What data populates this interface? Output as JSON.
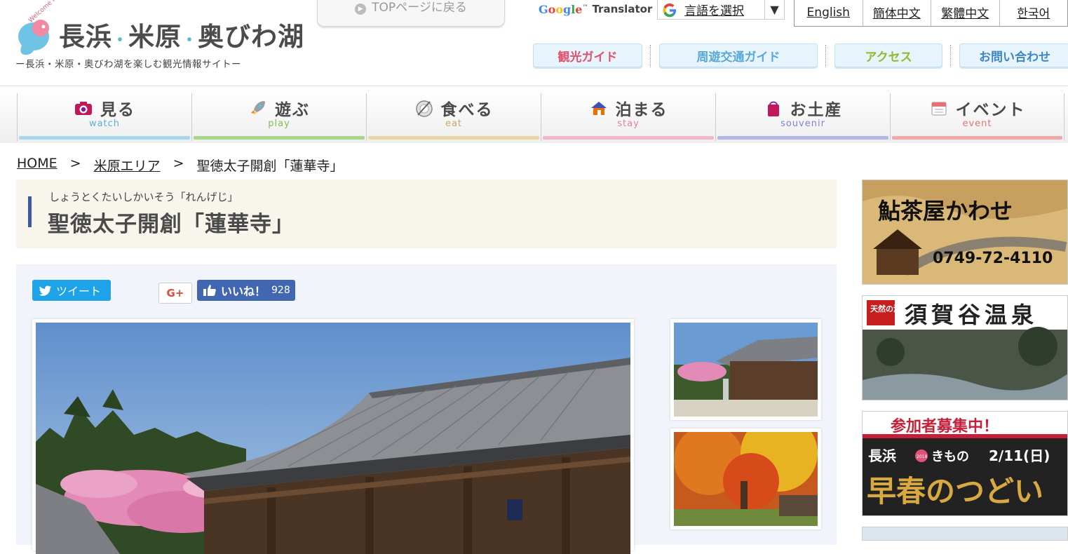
{
  "header": {
    "logo": {
      "welcome": "Welcome Here",
      "title_parts": [
        "長浜",
        "米原",
        "奥びわ湖"
      ],
      "separator": "・",
      "subtitle": "ー長浜・米原・奥びわ湖を楽しむ観光情報サイトー"
    },
    "top_back_label": "TOPページに戻る",
    "translator": {
      "brand_letters": [
        "G",
        "o",
        "o",
        "g",
        "l",
        "e"
      ],
      "brand_tm": "™",
      "label": "Translator",
      "select_label": "言語を選択",
      "arrow": "▼"
    },
    "languages": [
      "English",
      "簡体中文",
      "繁體中文",
      "한국어"
    ],
    "subnav": [
      {
        "label": "観光ガイド",
        "color": "#e0506b"
      },
      {
        "label": "周遊交通ガイド",
        "color": "#58a9d6"
      },
      {
        "label": "アクセス",
        "color": "#8dbb2f"
      },
      {
        "label": "お問い合わせ",
        "color": "#3e86c6"
      }
    ]
  },
  "main_nav": [
    {
      "label": "見る",
      "en": "watch",
      "icon": "camera-icon",
      "color": "#a6d8ec",
      "en_color": "#5bb0d6"
    },
    {
      "label": "遊ぶ",
      "en": "play",
      "icon": "rocket-icon",
      "color": "#a7d58a",
      "en_color": "#7fbf4d"
    },
    {
      "label": "食べる",
      "en": "eat",
      "icon": "dish-icon",
      "color": "#e8d7a4",
      "en_color": "#c9a860"
    },
    {
      "label": "泊まる",
      "en": "stay",
      "icon": "house-icon",
      "color": "#f2b6c6",
      "en_color": "#e57f9c"
    },
    {
      "label": "お土産",
      "en": "souvenir",
      "icon": "bag-icon",
      "color": "#b2b6e8",
      "en_color": "#7b84d6"
    },
    {
      "label": "イベント",
      "en": "event",
      "icon": "calendar-icon",
      "color": "#f1a8a8",
      "en_color": "#e07474"
    }
  ],
  "breadcrumb": {
    "home": "HOME",
    "sep": ">",
    "area": "米原エリア",
    "current": "聖徳太子開創「蓮華寺」"
  },
  "page": {
    "ruby": "しょうとくたいしかいそう「れんげじ」",
    "title": "聖徳太子開創「蓮華寺」"
  },
  "social": {
    "tweet_label": "ツイート",
    "gplus_label": "G+",
    "like_label": "いいね！",
    "like_count": "928"
  },
  "banners": [
    {
      "name": "ayuchaya-kawase-banner",
      "title": "鮎茶屋かわせ",
      "phone": "0749-72-4110"
    },
    {
      "name": "sugatani-onsen-banner",
      "badge": "天然の湯",
      "title": "須賀谷温泉"
    },
    {
      "name": "kimono-event-banner",
      "header": "参加者募集中！",
      "line1": "長浜",
      "line1b": "きもの",
      "date": "2/11(日)",
      "title": "早春のつどい",
      "badge": "2018"
    }
  ]
}
